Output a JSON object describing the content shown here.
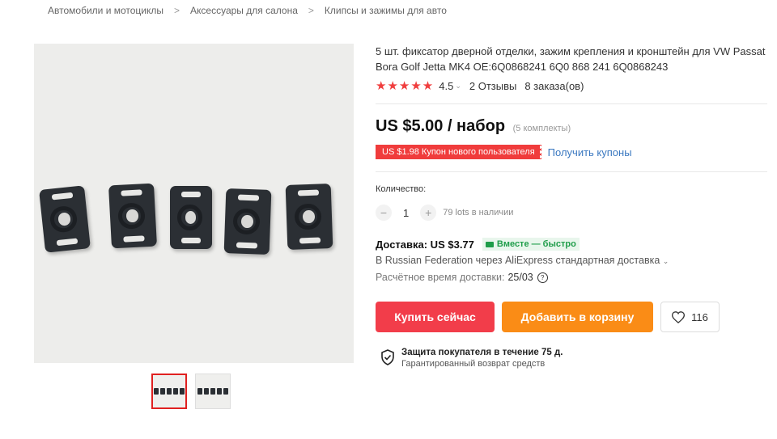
{
  "breadcrumb": {
    "items": [
      "Автомобили и мотоциклы",
      "Аксессуары для салона",
      "Клипсы и зажимы для авто"
    ],
    "separator": ">"
  },
  "product": {
    "title": "5 шт. фиксатор дверной отделки, зажим крепления и кронштейн для VW Passat Bora Golf Jetta MK4 OE:6Q0868241 6Q0 868 241 6Q0868243",
    "rating": {
      "stars": "★★★★★",
      "value": "4.5",
      "reviews": "2 Отзывы",
      "orders": "8 заказа(ов)"
    },
    "price": {
      "main": "US $5.00 / набор",
      "note": "(5 комплекты)"
    },
    "coupon": {
      "label": "US $1.98 Купон нового пользователя",
      "link": "Получить купоны"
    },
    "quantity": {
      "label": "Количество:",
      "value": "1",
      "minus": "−",
      "plus": "+",
      "stock": "79 lots в наличии"
    },
    "shipping": {
      "label": "Доставка: US $3.77",
      "badge": "Вместе — быстро",
      "detail": "В Russian Federation через AliExpress стандартная доставка",
      "eta_label": "Расчётное время доставки:",
      "eta_date": "25/03",
      "eta_help": "?"
    },
    "actions": {
      "buy_now": "Купить сейчас",
      "add_to_cart": "Добавить в корзину",
      "wishlist_count": "116"
    },
    "protection": {
      "title": "Защита покупателя в течение 75 д.",
      "subtitle": "Гарантированный возврат средств"
    }
  },
  "colors": {
    "accent_red": "#f23d4a",
    "cart_orange": "#fa8c16",
    "coupon_red": "#f03c3c",
    "link_blue": "#3a78c0",
    "badge_green": "#1f9d4a",
    "star_red": "#f03e3e"
  },
  "icons": [
    "chevron-right-icon",
    "chevron-down-icon",
    "star-icon",
    "truck-icon",
    "help-circle-icon",
    "heart-icon",
    "shield-check-icon"
  ]
}
